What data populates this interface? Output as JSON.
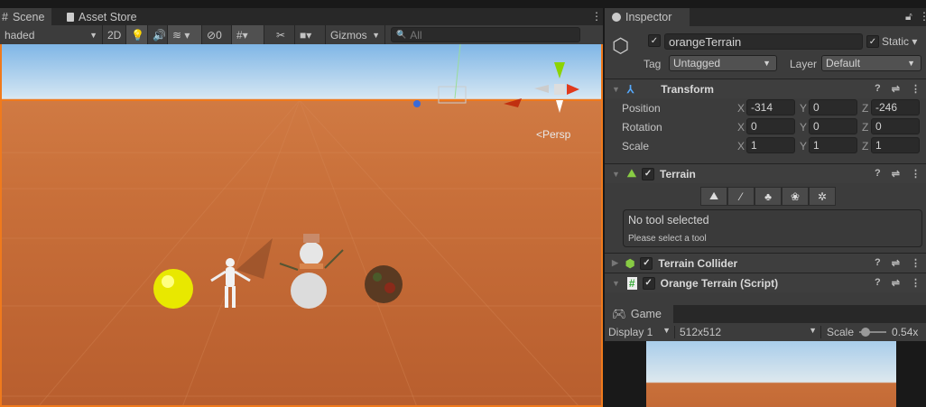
{
  "scene": {
    "tabs": [
      {
        "label": "Scene",
        "icon": "hash-icon"
      },
      {
        "label": "Asset Store",
        "icon": "bag-icon"
      }
    ],
    "toolbar": {
      "shading": "haded",
      "mode_2d": "2D",
      "hidden_count": "0",
      "gizmos": "Gizmos",
      "search_placeholder": "All"
    },
    "persp_label": "<Persp",
    "accent": "#f07a1c"
  },
  "inspector": {
    "tab": "Inspector",
    "object_name": "orangeTerrain",
    "static_label": "Static",
    "tag_label": "Tag",
    "tag_value": "Untagged",
    "layer_label": "Layer",
    "layer_value": "Default",
    "transform": {
      "title": "Transform",
      "rows": [
        {
          "label": "Position",
          "x": "-314",
          "y": "0",
          "z": "-246"
        },
        {
          "label": "Rotation",
          "x": "0",
          "y": "0",
          "z": "0"
        },
        {
          "label": "Scale",
          "x": "1",
          "y": "1",
          "z": "1"
        }
      ],
      "axes": [
        "X",
        "Y",
        "Z"
      ]
    },
    "terrain": {
      "title": "Terrain",
      "info_title": "No tool selected",
      "info_sub": "Please select a tool"
    },
    "terrain_collider": {
      "title": "Terrain Collider"
    },
    "script": {
      "title": "Orange Terrain (Script)"
    }
  },
  "game": {
    "tab": "Game",
    "display": "Display 1",
    "resolution": "512x512",
    "scale_label": "Scale",
    "scale_value": "0.54x",
    "scale_fraction": 0.1
  }
}
